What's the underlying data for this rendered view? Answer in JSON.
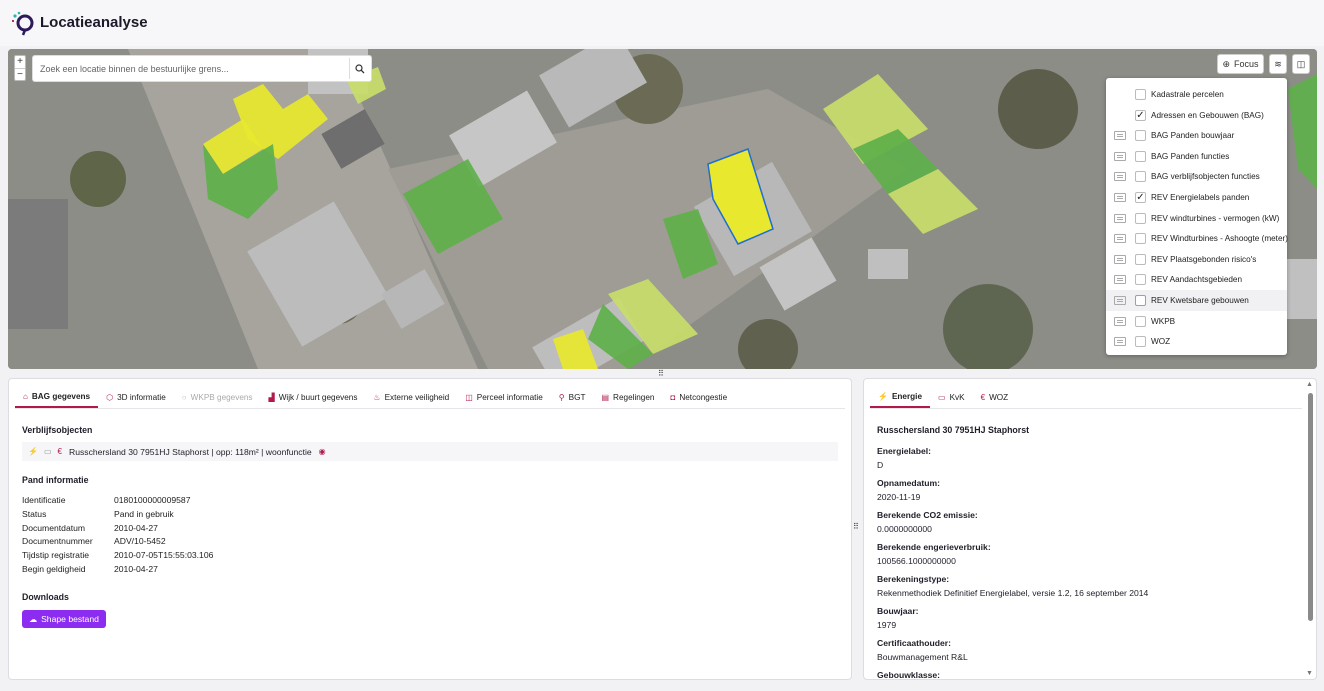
{
  "app": {
    "title": "Locatieanalyse",
    "brand_color": "#b0194a",
    "accent_color": "#8b2cf0"
  },
  "map": {
    "zoom_in": "+",
    "zoom_out": "−",
    "search_placeholder": "Zoek een locatie binnen de bestuurlijke grens...",
    "focus_label": "Focus",
    "layers": [
      {
        "label": "Kadastrale percelen",
        "checked": false,
        "legend": false
      },
      {
        "label": "Adressen en Gebouwen (BAG)",
        "checked": true,
        "legend": false
      },
      {
        "label": "BAG Panden bouwjaar",
        "checked": false,
        "legend": true
      },
      {
        "label": "BAG Panden functies",
        "checked": false,
        "legend": true
      },
      {
        "label": "BAG verblijfsobjecten functies",
        "checked": false,
        "legend": true
      },
      {
        "label": "REV Energielabels panden",
        "checked": true,
        "legend": true
      },
      {
        "label": "REV windturbines - vermogen (kW)",
        "checked": false,
        "legend": true
      },
      {
        "label": "REV Windturbines - Ashoogte (meter)",
        "checked": false,
        "legend": true
      },
      {
        "label": "REV Plaatsgebonden risico's",
        "checked": false,
        "legend": true
      },
      {
        "label": "REV Aandachtsgebieden",
        "checked": false,
        "legend": true
      },
      {
        "label": "REV Kwetsbare gebouwen",
        "checked": false,
        "legend": true
      },
      {
        "label": "WKPB",
        "checked": false,
        "legend": true
      },
      {
        "label": "WOZ",
        "checked": false,
        "legend": true
      }
    ]
  },
  "left_panel": {
    "tabs": [
      {
        "label": "BAG gegevens",
        "icon": "home-icon",
        "glyph": "⌂",
        "state": "active"
      },
      {
        "label": "3D informatie",
        "icon": "cube-icon",
        "glyph": "⬡",
        "state": "normal"
      },
      {
        "label": "WKPB gegevens",
        "icon": "circle-icon",
        "glyph": "○",
        "state": "disabled"
      },
      {
        "label": "Wijk / buurt gegevens",
        "icon": "buildings-icon",
        "glyph": "▟",
        "state": "normal"
      },
      {
        "label": "Externe veiligheid",
        "icon": "flame-icon",
        "glyph": "♨",
        "state": "normal"
      },
      {
        "label": "Perceel informatie",
        "icon": "map-icon",
        "glyph": "◫",
        "state": "normal"
      },
      {
        "label": "BGT",
        "icon": "link-icon",
        "glyph": "⚲",
        "state": "normal"
      },
      {
        "label": "Regelingen",
        "icon": "document-icon",
        "glyph": "▤",
        "state": "normal"
      },
      {
        "label": "Netcongestie",
        "icon": "plug-icon",
        "glyph": "◘",
        "state": "normal"
      }
    ],
    "verblijfsobjecten_title": "Verblijfsobjecten",
    "verblijfsobject_text": "Russchersland 30 7951HJ Staphorst | opp: 118m² | woonfunctie",
    "pand_title": "Pand informatie",
    "pand_info": [
      {
        "key": "Identificatie",
        "value": "0180100000009587"
      },
      {
        "key": "Status",
        "value": "Pand in gebruik"
      },
      {
        "key": "Documentdatum",
        "value": "2010-04-27"
      },
      {
        "key": "Documentnummer",
        "value": "ADV/10-5452"
      },
      {
        "key": "Tijdstip registratie",
        "value": "2010-07-05T15:55:03.106"
      },
      {
        "key": "Begin geldigheid",
        "value": "2010-04-27"
      }
    ],
    "downloads_title": "Downloads",
    "shape_button": "Shape bestand"
  },
  "right_panel": {
    "tabs": [
      {
        "label": "Energie",
        "icon": "bolt-icon",
        "glyph": "⚡",
        "state": "active"
      },
      {
        "label": "KvK",
        "icon": "storefront-icon",
        "glyph": "▭",
        "state": "normal"
      },
      {
        "label": "WOZ",
        "icon": "euro-icon",
        "glyph": "€",
        "state": "normal"
      }
    ],
    "address_title": "Russchersland 30 7951HJ Staphorst",
    "fields": [
      {
        "label": "Energielabel:",
        "value": "D"
      },
      {
        "label": "Opnamedatum:",
        "value": "2020-11-19"
      },
      {
        "label": "Berekende CO2 emissie:",
        "value": "0.0000000000"
      },
      {
        "label": "Berekende engerieverbruik:",
        "value": "100566.1000000000"
      },
      {
        "label": "Berekeningstype:",
        "value": "Rekenmethodiek Definitief Energielabel, versie 1.2, 16 september 2014"
      },
      {
        "label": "Bouwjaar:",
        "value": "1979"
      },
      {
        "label": "Certificaathouder:",
        "value": "Bouwmanagement R&L"
      },
      {
        "label": "Gebouwklasse:",
        "value": ""
      }
    ]
  }
}
